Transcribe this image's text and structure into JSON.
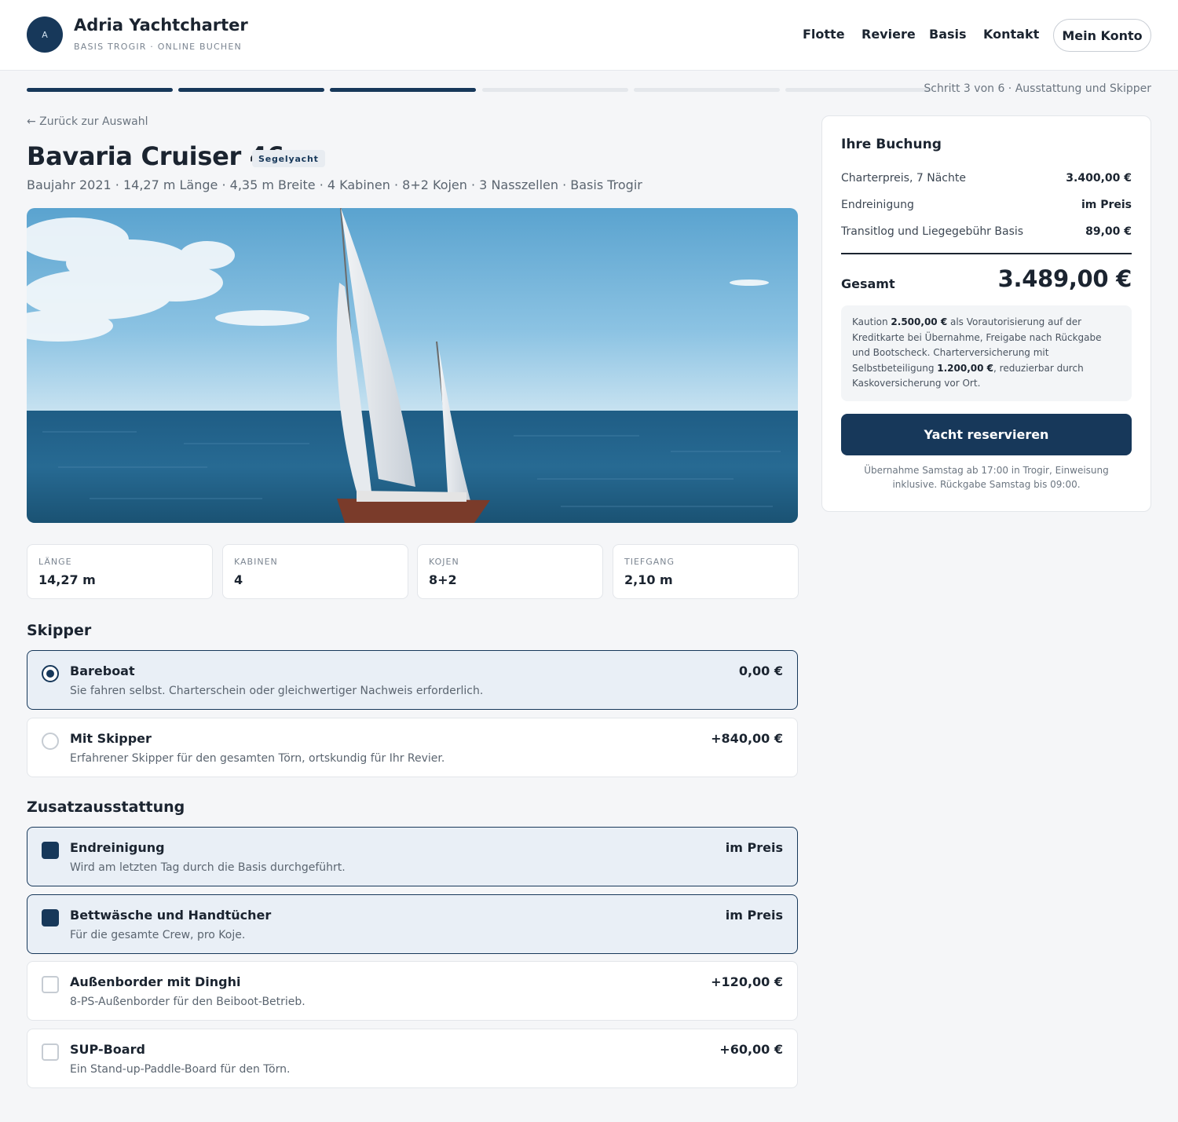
{
  "header": {
    "logo_letter": "A",
    "brand_name": "Adria Yachtcharter",
    "brand_sub": "BASIS TROGIR · ONLINE BUCHEN",
    "nav": [
      "Flotte",
      "Reviere",
      "Basis",
      "Kontakt"
    ],
    "account_label": "Mein Konto"
  },
  "stepper": {
    "current_step": 3,
    "total_steps": 6,
    "label": "Schritt 3 von 6 · Ausstattung und Skipper"
  },
  "back_link": "← Zurück zur Auswahl",
  "yacht": {
    "name": "Bavaria Cruiser 46",
    "type_badge": "Segelyacht",
    "specs_line": "Baujahr 2021 · 14,27 m Länge · 4,35 m Breite · 4 Kabinen · 8+2 Kojen · 3 Nasszellen · Basis Trogir",
    "spec_cards": [
      {
        "label": "LÄNGE",
        "value": "14,27 m"
      },
      {
        "label": "KABINEN",
        "value": "4"
      },
      {
        "label": "KOJEN",
        "value": "8+2"
      },
      {
        "label": "TIEFGANG",
        "value": "2,10 m"
      }
    ]
  },
  "skipper": {
    "title": "Skipper",
    "options": [
      {
        "name": "Bareboat",
        "desc": "Sie fahren selbst. Charterschein oder gleichwertiger Nachweis erforderlich.",
        "price": "0,00 €",
        "selected": true
      },
      {
        "name": "Mit Skipper",
        "desc": "Erfahrener Skipper für den gesamten Törn, ortskundig für Ihr Revier.",
        "price": "+840,00 €",
        "selected": false
      }
    ]
  },
  "extras": {
    "title": "Zusatzausstattung",
    "options": [
      {
        "name": "Endreinigung",
        "desc": "Wird am letzten Tag durch die Basis durchgeführt.",
        "price": "im Preis",
        "checked": true
      },
      {
        "name": "Bettwäsche und Handtücher",
        "desc": "Für die gesamte Crew, pro Koje.",
        "price": "im Preis",
        "checked": true
      },
      {
        "name": "Außenborder mit Dinghi",
        "desc": "8-PS-Außenborder für den Beiboot-Betrieb.",
        "price": "+120,00 €",
        "checked": false
      },
      {
        "name": "SUP-Board",
        "desc": "Ein Stand-up-Paddle-Board für den Törn.",
        "price": "+60,00 €",
        "checked": false
      }
    ]
  },
  "booking": {
    "title": "Ihre Buchung",
    "rows": [
      {
        "label": "Charterpreis, 7 Nächte",
        "value": "3.400,00 €"
      },
      {
        "label": "Endreinigung",
        "value": "im Preis"
      },
      {
        "label": "Transitlog und Liegegebühr Basis",
        "value": "89,00 €"
      }
    ],
    "total_label": "Gesamt",
    "total_value": "3.489,00 €",
    "note": {
      "t1": "Kaution ",
      "deposit": "2.500,00 €",
      "t2": " als Vorautorisierung auf der Kreditkarte bei Übernahme, Freigabe nach Rückgabe und Bootscheck. Charterversicherung mit Selbstbeteiligung ",
      "excess": "1.200,00 €",
      "t3": ", reduzierbar durch Kaskoversicherung vor Ort."
    },
    "cta_label": "Yacht reservieren",
    "footer": "Übernahme Samstag ab 17:00 in Trogir, Einweisung inklusive. Rückgabe Samstag bis 09:00."
  },
  "colors": {
    "primary": "#17385a",
    "selected_bg": "#e9eff6",
    "page_bg": "#f5f6f8"
  }
}
